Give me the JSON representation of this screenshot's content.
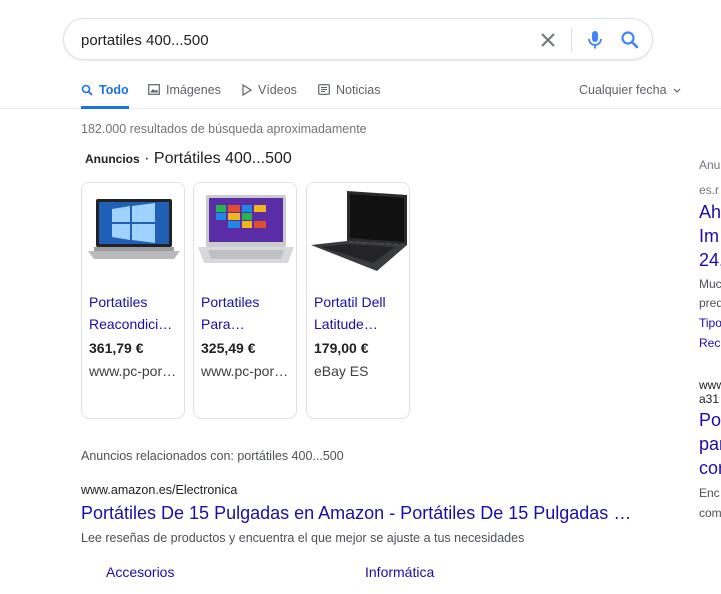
{
  "search": {
    "query": "portatiles 400...500"
  },
  "tabs": [
    {
      "label": "Todo",
      "icon": "search-icon"
    },
    {
      "label": "Imágenes",
      "icon": "image-icon"
    },
    {
      "label": "Vídeos",
      "icon": "play-icon"
    },
    {
      "label": "Noticias",
      "icon": "news-icon"
    }
  ],
  "date_filter": {
    "label": "Cualquier fecha"
  },
  "result_stats": "182.000 resultados de búsqueda aproximadamente",
  "ads": {
    "badge": "Anuncios",
    "separator": "·",
    "heading": "Portátiles 400...500",
    "products": [
      {
        "title_line1": "Portatiles",
        "title_line2": "Reacondici…",
        "price": "361,79 €",
        "merchant": "www.pc-por…"
      },
      {
        "title_line1": "Portatiles",
        "title_line2": "Para…",
        "price": "325,49 €",
        "merchant": "www.pc-por…"
      },
      {
        "title_line1": "Portatil Dell",
        "title_line2": "Latitude…",
        "price": "179,00 €",
        "merchant": "eBay ES"
      }
    ]
  },
  "related_ads": "Anuncios relacionados con: portátiles 400...500",
  "text_ad": {
    "url": "www.amazon.es/Electronica",
    "title": "Portátiles De 15 Pulgadas en Amazon - Portátiles De 15 Pulgadas a …",
    "description": "Lee reseñas de productos y encuentra el que mejor se ajuste a tus necesidades",
    "sitelinks": [
      "Accesorios",
      "Informática"
    ]
  },
  "right_column": {
    "label": "Anu",
    "url": "es.r",
    "title_lines": [
      "Ah",
      "Im",
      "24,"
    ],
    "desc_lines": [
      "Muc",
      "pred"
    ],
    "sitelinks": [
      "Tipo",
      "Rec"
    ],
    "url2_lines": [
      "www",
      "a31"
    ],
    "title2_lines": [
      "Po",
      "par",
      "cor"
    ],
    "desc2_lines": [
      "Enc",
      "com"
    ]
  }
}
